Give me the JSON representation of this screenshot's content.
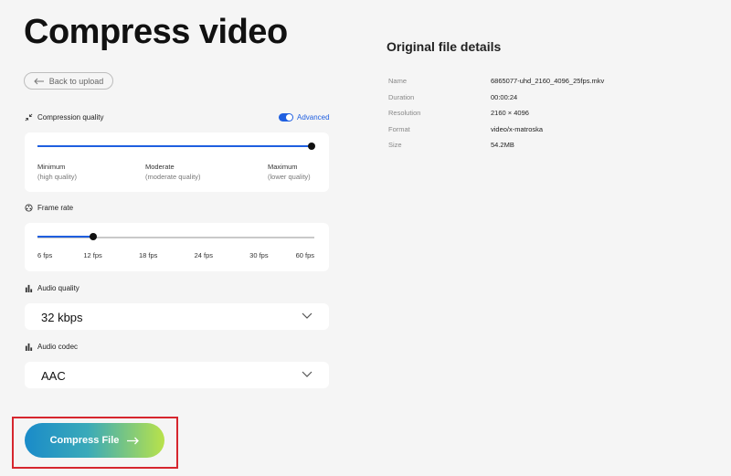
{
  "page": {
    "title": "Compress video",
    "back_label": "Back to upload"
  },
  "compression": {
    "label": "Compression quality",
    "toggle_label": "Advanced",
    "toggle_on": true,
    "level": 1.0,
    "ticks": [
      {
        "label": "Minimum",
        "sub": "(high quality)"
      },
      {
        "label": "Moderate",
        "sub": "(moderate quality)"
      },
      {
        "label": "Maximum",
        "sub": "(lower quality)"
      }
    ]
  },
  "frame_rate": {
    "label": "Frame rate",
    "selected": "12 fps",
    "options": [
      "6 fps",
      "12 fps",
      "18 fps",
      "24 fps",
      "30 fps",
      "60 fps"
    ]
  },
  "audio_quality": {
    "label": "Audio quality",
    "value": "32 kbps"
  },
  "audio_codec": {
    "label": "Audio codec",
    "value": "AAC"
  },
  "compress_button": {
    "label": "Compress File"
  },
  "details": {
    "title": "Original file details",
    "rows": [
      {
        "key": "Name",
        "value": "6865077-uhd_2160_4096_25fps.mkv"
      },
      {
        "key": "Duration",
        "value": "00:00:24"
      },
      {
        "key": "Resolution",
        "value": "2160 × 4096"
      },
      {
        "key": "Format",
        "value": "video/x-matroska"
      },
      {
        "key": "Size",
        "value": "54.2MB"
      }
    ]
  },
  "colors": {
    "accent": "#1f5fe0",
    "highlight": "#d6262e",
    "gradient_start": "#1a8bc9",
    "gradient_end": "#b9e24a"
  }
}
